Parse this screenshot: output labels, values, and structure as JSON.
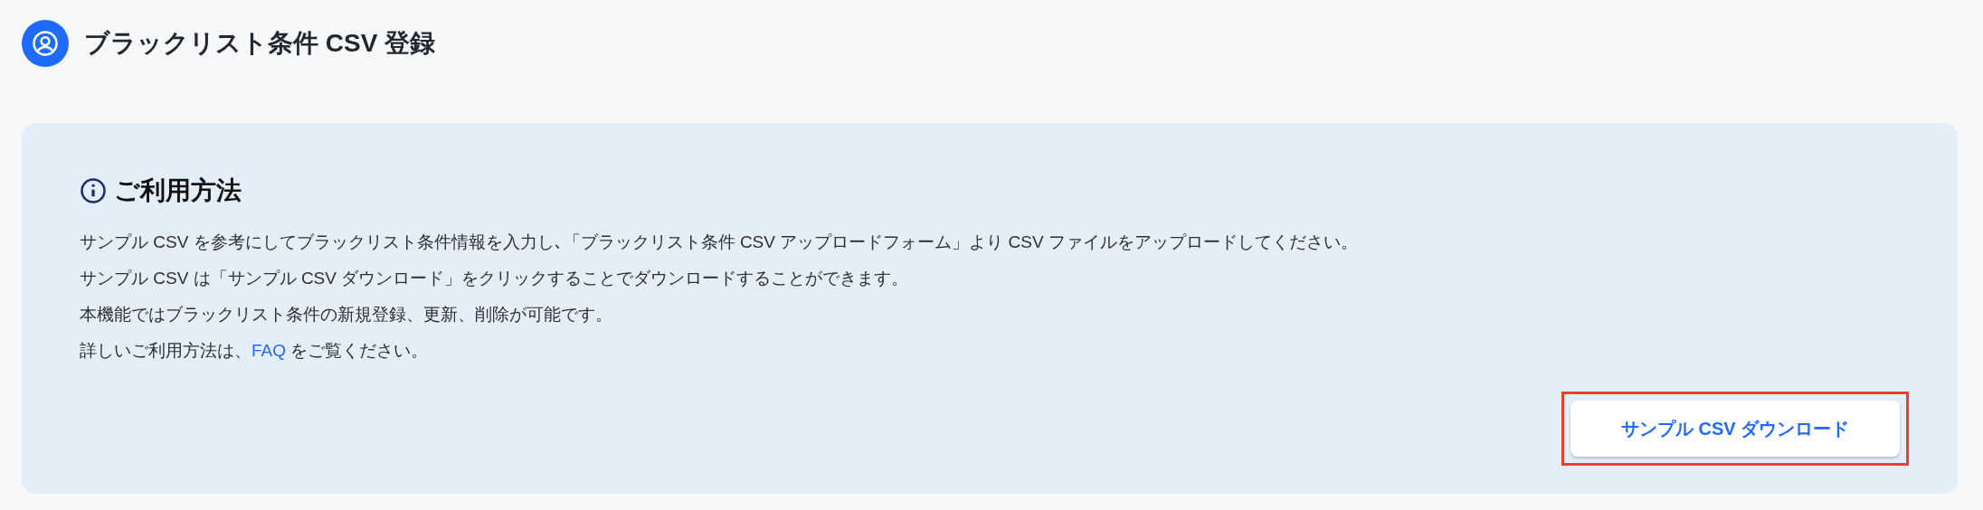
{
  "page_title": "ブラックリスト条件 CSV 登録",
  "usage": {
    "heading": "ご利用方法",
    "lines": [
      {
        "text": "サンプル CSV を参考にしてブラックリスト条件情報を入力し､「ブラックリスト条件 CSV アップロードフォーム」より CSV ファイルをアップロードしてください。"
      },
      {
        "text": "サンプル CSV は「サンプル CSV ダウンロード」をクリックすることでダウンロードすることができます。"
      },
      {
        "text": "本機能ではブラックリスト条件の新規登録、更新、削除が可能です。"
      },
      {
        "text": "詳しいご利用方法は、",
        "link": "FAQ",
        "after": " をご覧ください。"
      }
    ],
    "download_button": {
      "label": "サンプル CSV ダウンロード",
      "highlighted": true
    }
  }
}
